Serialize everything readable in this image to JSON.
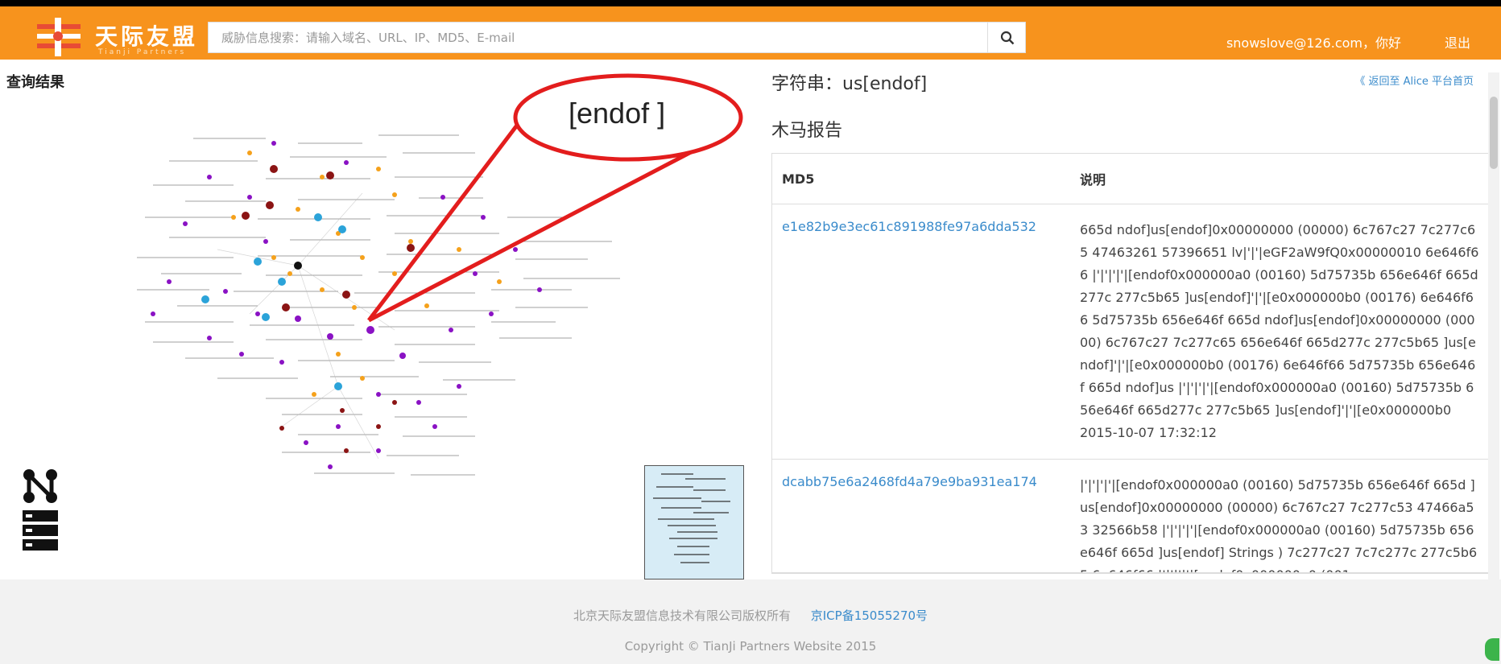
{
  "brand": {
    "name": "天际友盟",
    "sub": "Tianji Partners"
  },
  "search": {
    "placeholder": "威胁信息搜索：请输入域名、URL、IP、MD5、E-mail"
  },
  "user": {
    "greeting": "snowslove@126.com，你好",
    "logout": "退出"
  },
  "page": {
    "result_title": "查询结果",
    "string_title": "字符串：us[endof]",
    "back_link": "《 返回至 Alice 平台首页",
    "report_title": "木马报告"
  },
  "annotation": {
    "label": "[endof ]"
  },
  "table": {
    "headers": {
      "md5": "MD5",
      "desc": "说明"
    },
    "rows": [
      {
        "md5": "e1e82b9e3ec61c891988fe97a6dda532",
        "desc": "665d ndof]us[endof]0x00000000 (00000) 6c767c27 7c277c65 47463261 57396651 lv|'|'|eGF2aW9fQ0x00000010 6e646f66 |'|'|'|'|[endof0x000000a0 (00160) 5d75735b 656e646f 665d277c 277c5b65 ]us[endof]'|'|[e0x000000b0 (00176) 6e646f66 5d75735b 656e646f 665d ndof]us[endof]0x00000000 (00000) 6c767c27 7c277c65 656e646f 665d277c 277c5b65 ]us[endof]'|'|[e0x000000b0 (00176) 6e646f66 5d75735b 656e646f 665d ndof]us |'|'|'|'|[endof0x000000a0 (00160) 5d75735b 656e646f 665d277c 277c5b65 ]us[endof]'|'|[e0x000000b0",
        "date": "2015-10-07 17:32:12"
      },
      {
        "md5": "dcabb75e6a2468fd4a79e9ba931ea174",
        "desc": "|'|'|'|'|[endof0x000000a0 (00160) 5d75735b 656e646f 665d ]us[endof]0x00000000 (00000) 6c767c27 7c277c53 47466a53 32566b58 |'|'|'|'|[endof0x000000a0 (00160) 5d75735b 656e646f 665d ]us[endof] Strings ) 7c277c27 7c7c277c 277c5b65 6e646f66 |'|'|'|'|[endof0x000000a0 (001"
      }
    ]
  },
  "footer": {
    "company": "北京天际友盟信息技术有限公司版权所有",
    "icp": "京ICP备15055270号",
    "copyright": "Copyright © TianJi Partners Website 2015"
  },
  "colors": {
    "header": "#f7931d",
    "link": "#3a8bcb"
  }
}
